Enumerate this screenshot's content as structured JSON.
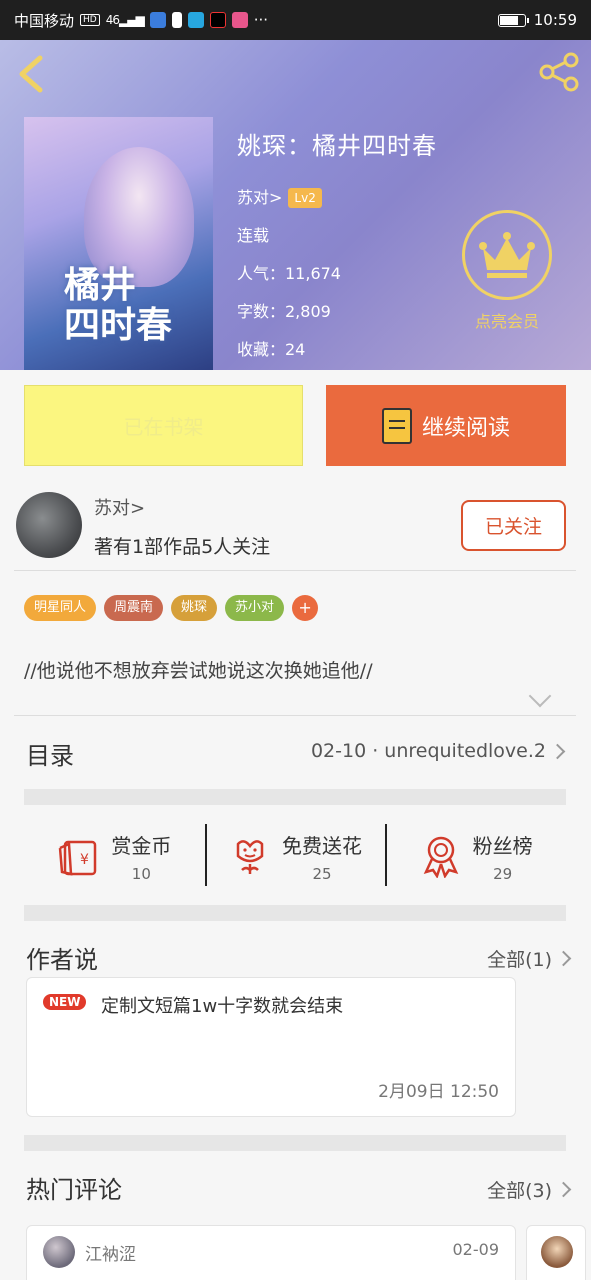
{
  "status_bar": {
    "carrier": "中国移动",
    "hd": "HD",
    "signal": "46",
    "more": "···",
    "time": "10:59"
  },
  "header": {
    "book_title": "姚琛：橘井四时春",
    "cover_title_line1": "橘井",
    "cover_title_line2": "四时春",
    "author": "苏对>",
    "level": "Lv2",
    "status": "连载",
    "popularity": "人气：11,674",
    "word_count": "字数：2,809",
    "favorites": "收藏：24",
    "vip_label": "点亮会员",
    "accent_color": "#f0d264"
  },
  "actions": {
    "shelf_label": "已在书架",
    "read_label": "继续阅读"
  },
  "author_row": {
    "name": "苏对>",
    "stats": "著有1部作品5人关注",
    "follow_label": "已关注"
  },
  "tags": [
    {
      "label": "明星同人",
      "color": "#f2a93b"
    },
    {
      "label": "周震南",
      "color": "#c9694f"
    },
    {
      "label": "姚琛",
      "color": "#d6a03a"
    },
    {
      "label": "苏小对",
      "color": "#8cb84a"
    }
  ],
  "tag_add": "+",
  "summary": "//他说他不想放弃尝试她说这次换她追他//",
  "catalog": {
    "title": "目录",
    "latest": "02-10 · unrequitedlove.2"
  },
  "stats": [
    {
      "label": "赏金币",
      "value": "10",
      "icon": "coin-envelope-icon"
    },
    {
      "label": "免费送花",
      "value": "25",
      "icon": "flower-icon"
    },
    {
      "label": "粉丝榜",
      "value": "29",
      "icon": "medal-icon"
    }
  ],
  "author_says": {
    "title": "作者说",
    "all_label": "全部(1)",
    "badge": "NEW",
    "note": "定制文短篇1w十字数就会结束",
    "date": "2月09日 12:50"
  },
  "comments": {
    "title": "热门评论",
    "all_label": "全部(3)",
    "items": [
      {
        "user": "江衲涩",
        "date": "02-09"
      }
    ]
  }
}
